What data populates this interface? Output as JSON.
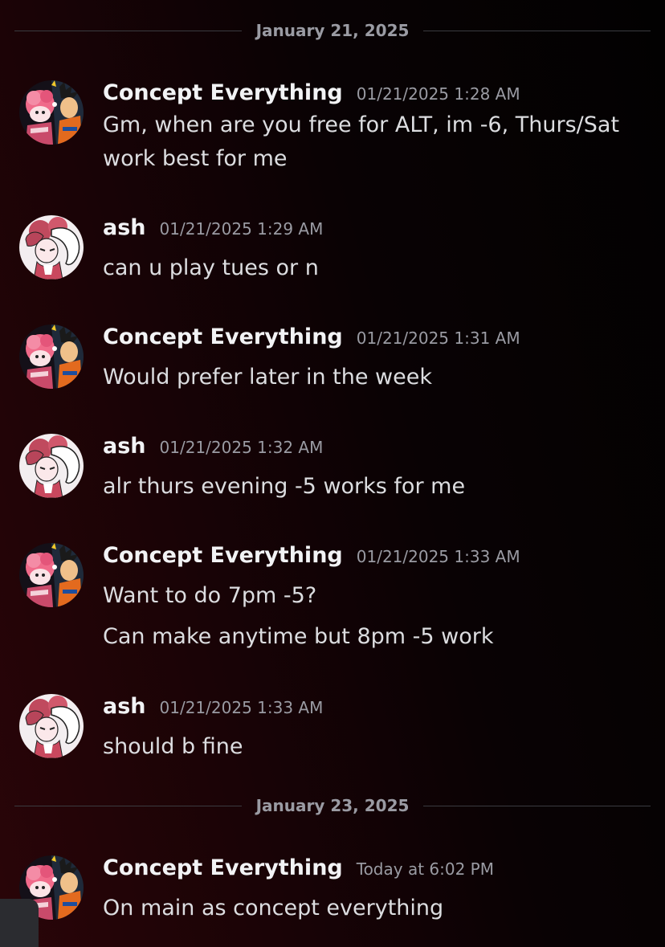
{
  "dividers": [
    {
      "date": "January 21, 2025"
    },
    {
      "date": "January 23, 2025"
    }
  ],
  "messages": [
    {
      "author": "Concept Everything",
      "timestamp": "01/21/2025 1:28 AM",
      "avatar_icon": "goku-collage-avatar-icon",
      "lines": [
        "Gm, when are you free for ALT, im -6, Thurs/Sat",
        "work best for me"
      ]
    },
    {
      "author": "ash",
      "timestamp": "01/21/2025 1:29 AM",
      "avatar_icon": "pink-character-avatar-icon",
      "lines": [
        "can u play tues or n"
      ]
    },
    {
      "author": "Concept Everything",
      "timestamp": "01/21/2025 1:31 AM",
      "avatar_icon": "goku-collage-avatar-icon",
      "lines": [
        "Would prefer later in the week"
      ]
    },
    {
      "author": "ash",
      "timestamp": "01/21/2025 1:32 AM",
      "avatar_icon": "pink-character-avatar-icon",
      "lines": [
        "alr thurs evening -5 works for me"
      ]
    },
    {
      "author": "Concept Everything",
      "timestamp": "01/21/2025 1:33 AM",
      "avatar_icon": "goku-collage-avatar-icon",
      "lines": [
        "Want to do 7pm -5?",
        "Can make anytime but 8pm -5 work"
      ]
    },
    {
      "author": "ash",
      "timestamp": "01/21/2025 1:33 AM",
      "avatar_icon": "pink-character-avatar-icon",
      "lines": [
        "should b fine"
      ]
    },
    {
      "author": "Concept Everything",
      "timestamp": "Today at 6:02 PM",
      "avatar_icon": "goku-collage-avatar-icon",
      "lines": [
        "On main as concept everything"
      ]
    }
  ],
  "colors": {
    "background_accent": "#2a0508",
    "author": "#f2f3f5",
    "timestamp": "#9a9ba3",
    "message_text": "#dcdde0",
    "divider_line": "#3a3b40"
  }
}
